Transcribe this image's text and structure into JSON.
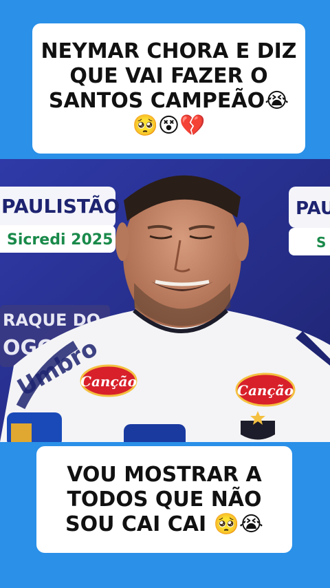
{
  "top_caption": {
    "text": "NEYMAR CHORA E DIZ QUE VAI FAZER O SANTOS CAMPEÃO😭🥺😵💔"
  },
  "bottom_caption": {
    "text": "VOU MOSTRAR A TODOS QUE NÃO SOU CAI CAI 🥺😭"
  },
  "video": {
    "board_left_line1": "PAULISTÃO",
    "board_left_line2": "Sicredi 2025",
    "board_right_line1": "PAUL",
    "board_right_line2": "S",
    "board_left_lower1": "RAQUE DO",
    "board_left_lower2": "OGO",
    "sponsor_left": "Canção",
    "sponsor_right": "Canção",
    "jersey_text": "Umbro"
  },
  "colors": {
    "background": "#2a90e8",
    "caption_bg": "#ffffff",
    "caption_text": "#111111",
    "backdrop": "#2a2f8f",
    "sponsor_red": "#d8202a"
  }
}
